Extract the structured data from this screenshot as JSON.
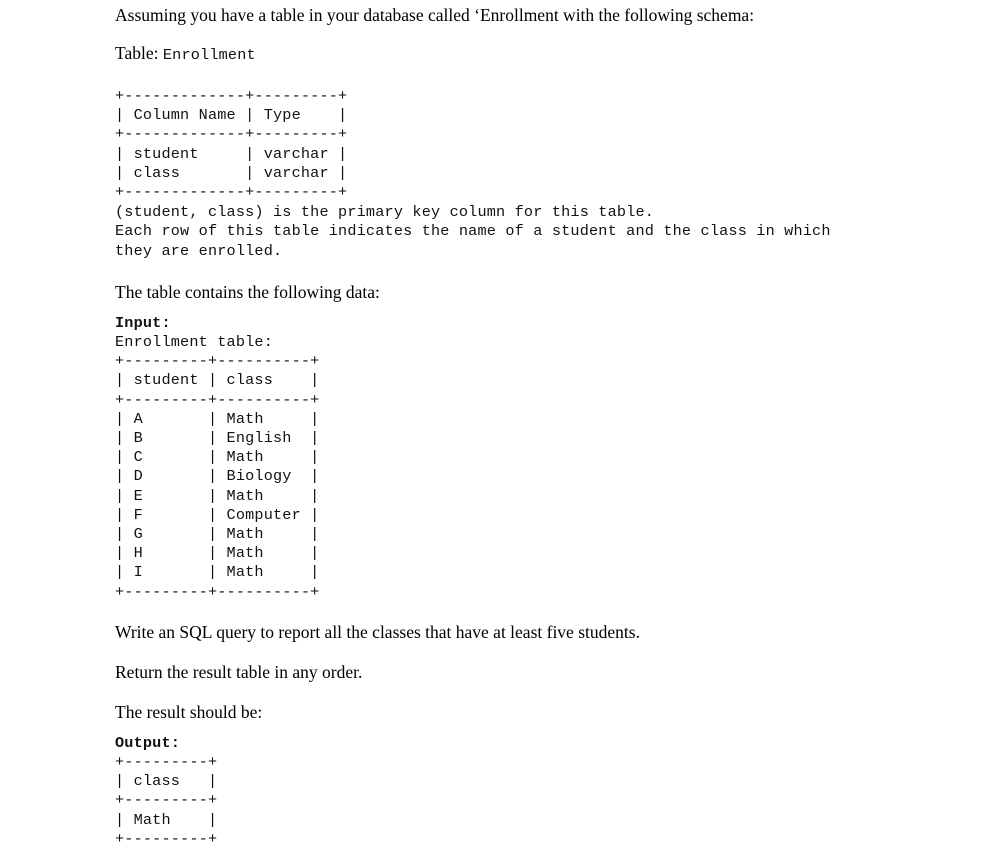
{
  "document": {
    "intro": "Assuming you have a table in your database called ‘Enrollment with the following schema:",
    "table_label": "Table: ",
    "table_name": "Enrollment",
    "schema_table": "+-------------+---------+\n| Column Name | Type    |\n+-------------+---------+\n| student     | varchar |\n| class       | varchar |\n+-------------+---------+",
    "schema_description": "(student, class) is the primary key column for this table.\nEach row of this table indicates the name of a student and the class in which\nthey are enrolled.",
    "contains_line": "The table contains the following data:",
    "input_label": "Input:",
    "input_caption": "Enrollment table:",
    "input_table": "+---------+----------+\n| student | class    |\n+---------+----------+\n| A       | Math     |\n| B       | English  |\n| C       | Math     |\n| D       | Biology  |\n| E       | Math     |\n| F       | Computer |\n| G       | Math     |\n| H       | Math     |\n| I       | Math     |\n+---------+----------+",
    "question_line": "Write an SQL query to report all the classes that have at least five students.",
    "order_line": "Return the result table in any order.",
    "result_line": "The result should be:",
    "output_label": "Output:",
    "output_table": "+---------+\n| class   |\n+---------+\n| Math    |\n+---------+"
  },
  "schema_data": {
    "columns": [
      "Column Name",
      "Type"
    ],
    "rows": [
      [
        "student",
        "varchar"
      ],
      [
        "class",
        "varchar"
      ]
    ]
  },
  "enrollment_data": {
    "columns": [
      "student",
      "class"
    ],
    "rows": [
      [
        "A",
        "Math"
      ],
      [
        "B",
        "English"
      ],
      [
        "C",
        "Math"
      ],
      [
        "D",
        "Biology"
      ],
      [
        "E",
        "Math"
      ],
      [
        "F",
        "Computer"
      ],
      [
        "G",
        "Math"
      ],
      [
        "H",
        "Math"
      ],
      [
        "I",
        "Math"
      ]
    ]
  },
  "output_data": {
    "columns": [
      "class"
    ],
    "rows": [
      [
        "Math"
      ]
    ]
  },
  "colors": {
    "background": "#ffffff",
    "text": "#000000",
    "mono_text": "#111111"
  }
}
